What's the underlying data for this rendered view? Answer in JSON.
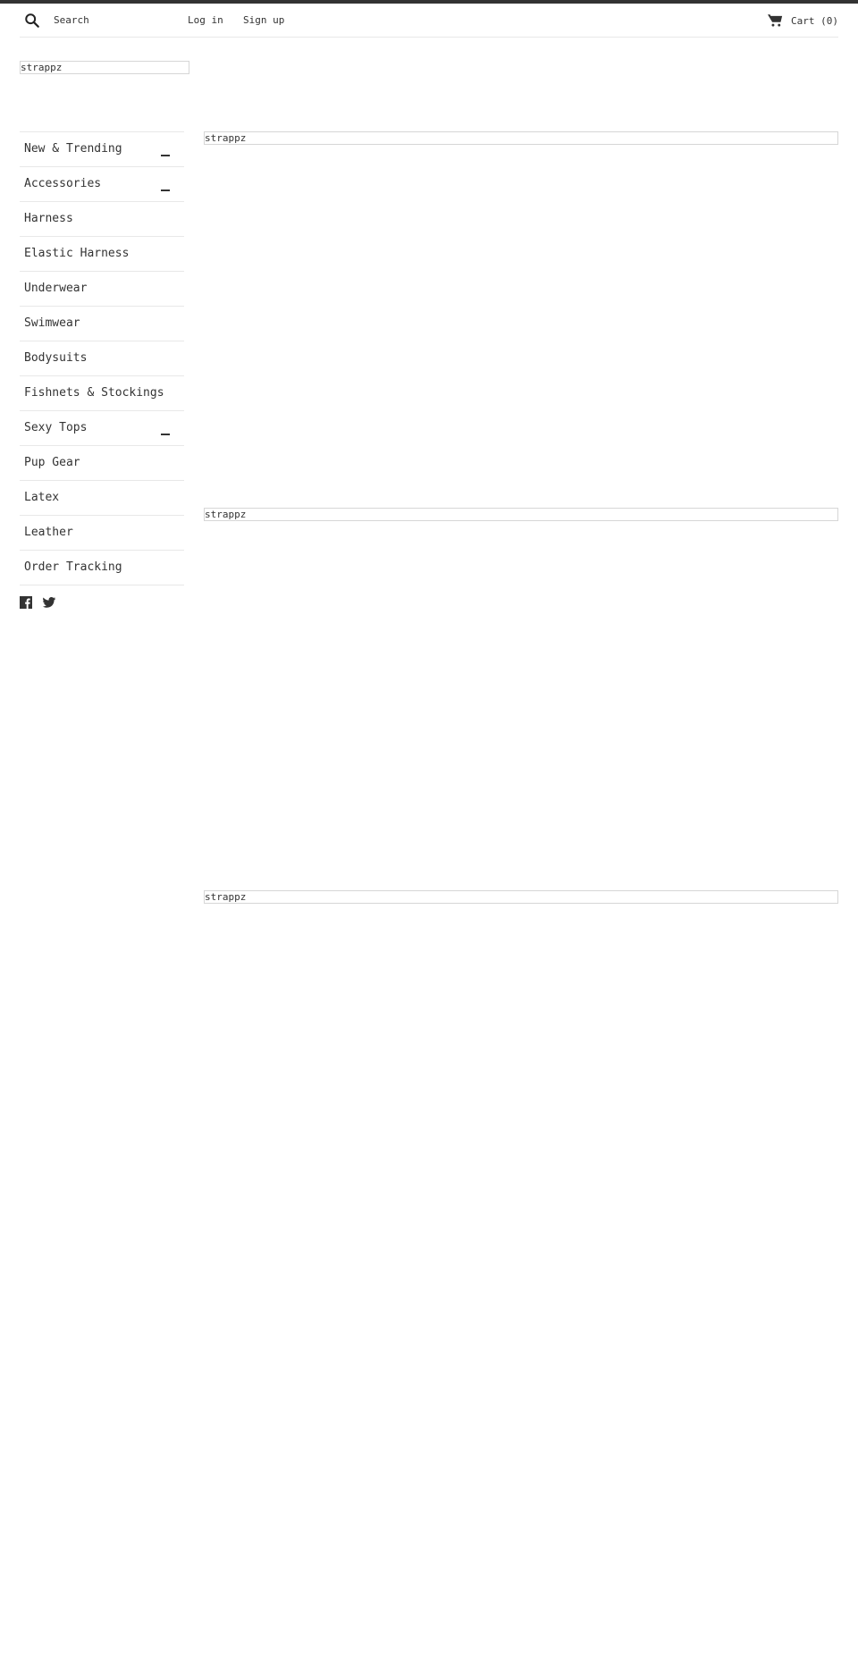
{
  "header": {
    "search_placeholder": "Search",
    "login_label": "Log in",
    "signup_label": "Sign up",
    "cart_label": "Cart (0)",
    "icons": {
      "search": "search-icon",
      "cart": "cart-icon"
    }
  },
  "logo": {
    "alt_text": "strappz"
  },
  "sidebar": {
    "items": [
      {
        "label": "New & Trending",
        "expandable": true
      },
      {
        "label": "Accessories",
        "expandable": true
      },
      {
        "label": "Harness",
        "expandable": false
      },
      {
        "label": "Elastic Harness",
        "expandable": false
      },
      {
        "label": "Underwear",
        "expandable": false
      },
      {
        "label": "Swimwear",
        "expandable": false
      },
      {
        "label": "Bodysuits",
        "expandable": false
      },
      {
        "label": "Fishnets & Stockings",
        "expandable": false
      },
      {
        "label": "Sexy Tops",
        "expandable": true
      },
      {
        "label": "Pup Gear",
        "expandable": false
      },
      {
        "label": "Latex",
        "expandable": false
      },
      {
        "label": "Leather",
        "expandable": false
      },
      {
        "label": "Order Tracking",
        "expandable": false
      }
    ],
    "social": [
      "facebook-icon",
      "twitter-icon"
    ]
  },
  "main": {
    "images": [
      {
        "alt_text": "strappz"
      },
      {
        "alt_text": "strappz"
      },
      {
        "alt_text": "strappz"
      }
    ]
  },
  "colors": {
    "text": "#333333",
    "border": "#e8e8e8",
    "topbar": "#333333"
  }
}
